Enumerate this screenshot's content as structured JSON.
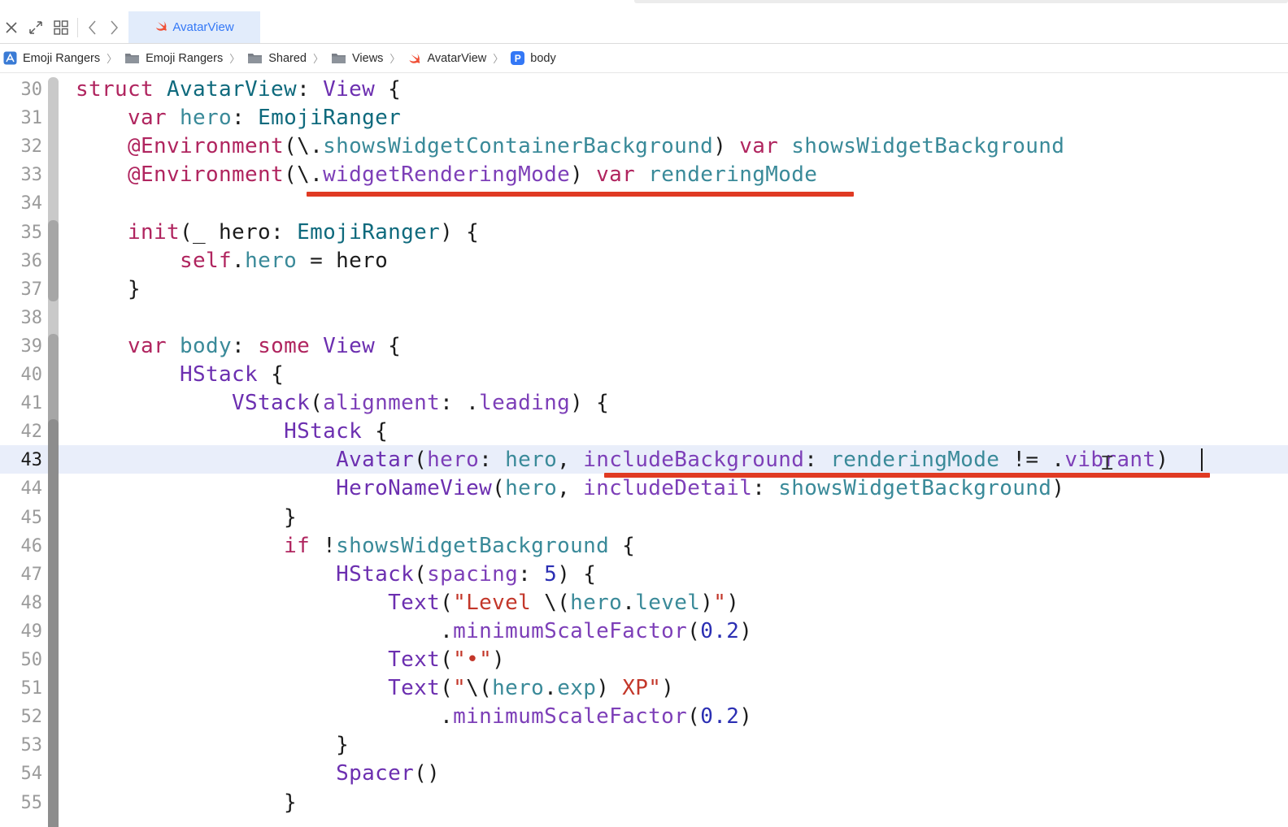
{
  "tab": {
    "title": "AvatarView"
  },
  "breadcrumb": [
    {
      "label": "Emoji Rangers",
      "icon": "project-icon"
    },
    {
      "label": "Emoji Rangers",
      "icon": "folder-icon"
    },
    {
      "label": "Shared",
      "icon": "folder-icon"
    },
    {
      "label": "Views",
      "icon": "folder-icon"
    },
    {
      "label": "AvatarView",
      "icon": "swift-file-icon"
    },
    {
      "label": "body",
      "icon": "property-icon",
      "badge": "P"
    }
  ],
  "editor": {
    "current_line": 43,
    "line_numbers": [
      "30",
      "31",
      "32",
      "33",
      "34",
      "35",
      "36",
      "37",
      "38",
      "39",
      "40",
      "41",
      "42",
      "43",
      "44",
      "45",
      "46",
      "47",
      "48",
      "49",
      "50",
      "51",
      "52",
      "53",
      "54",
      "55"
    ],
    "lines": [
      [
        [
          "kw",
          "struct "
        ],
        [
          "tyd",
          "AvatarView"
        ],
        [
          "",
          ": "
        ],
        [
          "pu",
          "View"
        ],
        [
          "",
          " {"
        ]
      ],
      [
        [
          "",
          "    "
        ],
        [
          "kw",
          "var "
        ],
        [
          "ty",
          "hero"
        ],
        [
          "",
          ": "
        ],
        [
          "tyd",
          "EmojiRanger"
        ]
      ],
      [
        [
          "",
          "    "
        ],
        [
          "kw",
          "@Environment"
        ],
        [
          "",
          "(\\."
        ],
        [
          "ty",
          "showsWidgetContainerBackground"
        ],
        [
          "",
          ") "
        ],
        [
          "kw",
          "var "
        ],
        [
          "ty",
          "showsWidgetBackground"
        ]
      ],
      [
        [
          "",
          "    "
        ],
        [
          "kw",
          "@Environment"
        ],
        [
          "",
          "(\\."
        ],
        [
          "pl",
          "widgetRenderingMode"
        ],
        [
          "",
          ") "
        ],
        [
          "kw",
          "var "
        ],
        [
          "ty",
          "renderingMode"
        ]
      ],
      [
        [
          "",
          ""
        ]
      ],
      [
        [
          "",
          "    "
        ],
        [
          "kw",
          "init"
        ],
        [
          "",
          "(_ hero: "
        ],
        [
          "tyd",
          "EmojiRanger"
        ],
        [
          "",
          ") {"
        ]
      ],
      [
        [
          "",
          "        "
        ],
        [
          "kw",
          "self"
        ],
        [
          "",
          "."
        ],
        [
          "ty",
          "hero"
        ],
        [
          "",
          " = hero"
        ]
      ],
      [
        [
          "",
          "    }"
        ]
      ],
      [
        [
          "",
          ""
        ]
      ],
      [
        [
          "",
          "    "
        ],
        [
          "kw",
          "var "
        ],
        [
          "ty",
          "body"
        ],
        [
          "",
          ": "
        ],
        [
          "kw",
          "some "
        ],
        [
          "pu",
          "View"
        ],
        [
          "",
          " {"
        ]
      ],
      [
        [
          "",
          "        "
        ],
        [
          "pu",
          "HStack"
        ],
        [
          "",
          " {"
        ]
      ],
      [
        [
          "",
          "            "
        ],
        [
          "pu",
          "VStack"
        ],
        [
          "",
          "("
        ],
        [
          "pl",
          "alignment"
        ],
        [
          "",
          ": ."
        ],
        [
          "pl",
          "leading"
        ],
        [
          "",
          ") {"
        ]
      ],
      [
        [
          "",
          "                "
        ],
        [
          "pu",
          "HStack"
        ],
        [
          "",
          " {"
        ]
      ],
      [
        [
          "",
          "                    "
        ],
        [
          "pu",
          "Avatar"
        ],
        [
          "",
          "("
        ],
        [
          "pl",
          "hero"
        ],
        [
          "",
          ": "
        ],
        [
          "ty",
          "hero"
        ],
        [
          "",
          ", "
        ],
        [
          "pl",
          "includeBackground"
        ],
        [
          "",
          ": "
        ],
        [
          "ty",
          "renderingMode"
        ],
        [
          "",
          " != ."
        ],
        [
          "pl",
          "vibrant"
        ],
        [
          "",
          ")"
        ]
      ],
      [
        [
          "",
          "                    "
        ],
        [
          "pu",
          "HeroNameView"
        ],
        [
          "",
          "("
        ],
        [
          "ty",
          "hero"
        ],
        [
          "",
          ", "
        ],
        [
          "pl",
          "includeDetail"
        ],
        [
          "",
          ": "
        ],
        [
          "ty",
          "showsWidgetBackground"
        ],
        [
          "",
          ")"
        ]
      ],
      [
        [
          "",
          "                }"
        ]
      ],
      [
        [
          "",
          "                "
        ],
        [
          "kw",
          "if "
        ],
        [
          "",
          "!"
        ],
        [
          "ty",
          "showsWidgetBackground"
        ],
        [
          "",
          " {"
        ]
      ],
      [
        [
          "",
          "                    "
        ],
        [
          "pu",
          "HStack"
        ],
        [
          "",
          "("
        ],
        [
          "pl",
          "spacing"
        ],
        [
          "",
          ": "
        ],
        [
          "nu",
          "5"
        ],
        [
          "",
          ") {"
        ]
      ],
      [
        [
          "",
          "                        "
        ],
        [
          "pu",
          "Text"
        ],
        [
          "",
          "("
        ],
        [
          "st",
          "\"Level "
        ],
        [
          "",
          "\\("
        ],
        [
          "ty",
          "hero"
        ],
        [
          "",
          "."
        ],
        [
          "ty",
          "level"
        ],
        [
          "",
          ")"
        ],
        [
          "st",
          "\""
        ],
        [
          "",
          ")"
        ]
      ],
      [
        [
          "",
          "                            ."
        ],
        [
          "pl",
          "minimumScaleFactor"
        ],
        [
          "",
          "("
        ],
        [
          "nu",
          "0.2"
        ],
        [
          "",
          ")"
        ]
      ],
      [
        [
          "",
          "                        "
        ],
        [
          "pu",
          "Text"
        ],
        [
          "",
          "("
        ],
        [
          "st",
          "\"•\""
        ],
        [
          "",
          ")"
        ]
      ],
      [
        [
          "",
          "                        "
        ],
        [
          "pu",
          "Text"
        ],
        [
          "",
          "("
        ],
        [
          "st",
          "\""
        ],
        [
          "",
          "\\("
        ],
        [
          "ty",
          "hero"
        ],
        [
          "",
          "."
        ],
        [
          "ty",
          "exp"
        ],
        [
          "",
          ")"
        ],
        [
          "st",
          " XP\""
        ],
        [
          "",
          ")"
        ]
      ],
      [
        [
          "",
          "                            ."
        ],
        [
          "pl",
          "minimumScaleFactor"
        ],
        [
          "",
          "("
        ],
        [
          "nu",
          "0.2"
        ],
        [
          "",
          ")"
        ]
      ],
      [
        [
          "",
          "                    }"
        ]
      ],
      [
        [
          "",
          "                    "
        ],
        [
          "pu",
          "Spacer"
        ],
        [
          "",
          "()"
        ]
      ],
      [
        [
          "",
          "                }"
        ]
      ]
    ]
  },
  "colors": {
    "keyword": "#b0255f",
    "type": "#3a8a99",
    "property": "#7d3fb8",
    "string": "#c3372a",
    "number": "#2b2fb3",
    "annotation_underline": "#e03a23",
    "tab_accent": "#3478f6"
  }
}
